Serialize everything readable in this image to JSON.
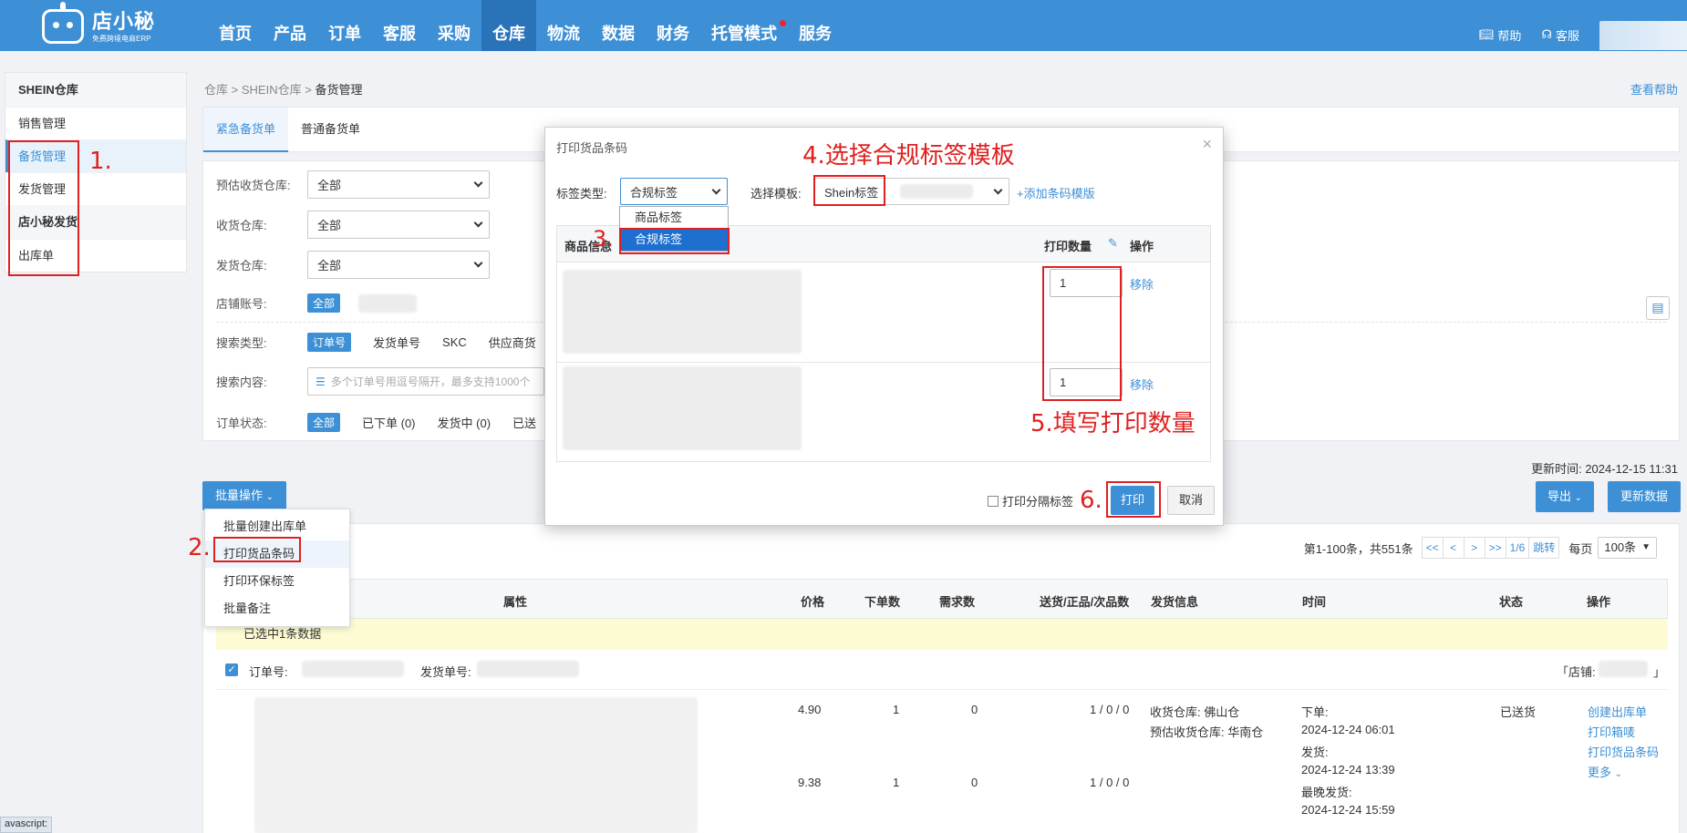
{
  "brand": {
    "name": "店小秘",
    "slogan": "免费跨境电商ERP"
  },
  "nav": {
    "items": [
      "首页",
      "产品",
      "订单",
      "客服",
      "采购",
      "仓库",
      "物流",
      "数据",
      "财务",
      "托管模式",
      "服务"
    ],
    "active": "仓库",
    "help": "帮助",
    "service": "客服"
  },
  "sidebar": {
    "group1": "SHEIN仓库",
    "items1": [
      "销售管理",
      "备货管理",
      "发货管理"
    ],
    "active": "备货管理",
    "group2": "店小秘发货",
    "items2": [
      "出库单"
    ]
  },
  "breadcrumb": {
    "a": "仓库",
    "sep": ">",
    "b": "SHEIN仓库",
    "c": "备货管理"
  },
  "help_link": "查看帮助",
  "tabs": [
    "紧急备货单",
    "普通备货单"
  ],
  "filters": {
    "expected_wh": "预估收货仓库:",
    "receive_wh": "收货仓库:",
    "ship_wh": "发货仓库:",
    "all": "全部",
    "store": "店铺账号:",
    "search_type": "搜索类型:",
    "search_types": [
      "订单号",
      "发货单号",
      "SKC",
      "供应商货"
    ],
    "search_content": "搜索内容:",
    "search_placeholder": "多个订单号用逗号隔开，最多支持1000个",
    "order_status": "订单状态:",
    "statuses": [
      "全部",
      "已下单 (0)",
      "发货中 (0)",
      "已送"
    ]
  },
  "batch": {
    "button": "批量操作",
    "menu": [
      "批量创建出库单",
      "打印货品条码",
      "打印环保标签",
      "批量备注"
    ]
  },
  "update_time": "更新时间: 2024-12-15 11:31",
  "export_btn": "导出",
  "refresh_btn": "更新数据",
  "pager": {
    "summary": "第1-100条，共551条",
    "first": "<<",
    "prev": "<",
    "next": ">",
    "last": ">>",
    "page": "1/6",
    "jump": "跳转",
    "per_page_label": "每页",
    "per_page": "100条"
  },
  "table": {
    "headers": [
      "属性",
      "价格",
      "下单数",
      "需求数",
      "送货/正品/次品数",
      "发货信息",
      "时间",
      "状态",
      "操作"
    ],
    "selected_info": "已选中1条数据",
    "order_no": "订单号:",
    "ship_no": "发货单号:",
    "store_open": "「店铺:",
    "store_close": "」",
    "row": {
      "price1": "4.90",
      "order1": "1",
      "demand1": "0",
      "qty1": "1 / 0 / 0",
      "price2": "9.38",
      "order2": "1",
      "demand2": "0",
      "qty2": "1 / 0 / 0",
      "recv_wh": "收货仓库: 佛山仓",
      "exp_wh": "预估收货仓库: 华南仓",
      "t_order_lbl": "下单:",
      "t_order": "2024-12-24 06:01",
      "t_ship_lbl": "发货:",
      "t_ship": "2024-12-24 13:39",
      "t_late_lbl": "最晚发货:",
      "t_late": "2024-12-24 15:59",
      "status": "已送货",
      "actions": [
        "创建出库单",
        "打印箱唛",
        "打印货品条码",
        "更多"
      ]
    }
  },
  "modal": {
    "title": "打印货品条码",
    "label_type": "标签类型:",
    "label_type_value": "合规标签",
    "template_label": "选择模板:",
    "template_value": "Shein标签",
    "add_template": "+添加条码模版",
    "dropdown": [
      "商品标签",
      "合规标签"
    ],
    "col_product": "商品信息",
    "col_qty": "打印数量",
    "col_op": "操作",
    "qty1": "1",
    "qty2": "1",
    "remove": "移除",
    "print_sep": "打印分隔标签",
    "print_btn": "打印",
    "cancel_btn": "取消"
  },
  "annotations": {
    "n1": "1.",
    "n2": "2.",
    "n3": "3.",
    "n4": "4.选择合规标签模板",
    "n5": "5.填写打印数量",
    "n6": "6."
  },
  "status_tip": "avascript:",
  "colors": {
    "brand": "#3d8fd6",
    "annotation": "#e02020",
    "highlight_row": "#fdfbd3"
  }
}
